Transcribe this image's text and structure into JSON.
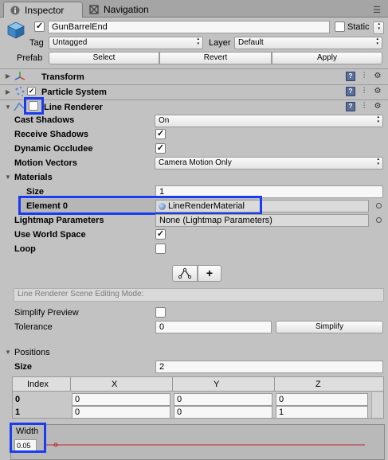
{
  "tabs": [
    {
      "label": "Inspector",
      "icon": "info-icon"
    },
    {
      "label": "Navigation",
      "icon": "navigation-icon"
    }
  ],
  "header": {
    "object_name": "GunBarrelEnd",
    "static_label": "Static",
    "tag_label": "Tag",
    "tag_value": "Untagged",
    "layer_label": "Layer",
    "layer_value": "Default",
    "prefab_label": "Prefab",
    "prefab_buttons": [
      "Select",
      "Revert",
      "Apply"
    ]
  },
  "components": {
    "transform": "Transform",
    "particle_system": "Particle System",
    "line_renderer": "Line Renderer"
  },
  "line_renderer": {
    "cast_shadows_label": "Cast Shadows",
    "cast_shadows_value": "On",
    "receive_shadows_label": "Receive Shadows",
    "dynamic_occludee_label": "Dynamic Occludee",
    "motion_vectors_label": "Motion Vectors",
    "motion_vectors_value": "Camera Motion Only",
    "materials_label": "Materials",
    "size_label": "Size",
    "size_value": "1",
    "element0_label": "Element 0",
    "element0_value": "LineRenderMaterial",
    "lightmap_label": "Lightmap Parameters",
    "lightmap_value": "None (Lightmap Parameters)",
    "world_space_label": "Use World Space",
    "loop_label": "Loop",
    "scene_editing_mode": "Line Renderer Scene Editing Mode:",
    "simplify_preview_label": "Simplify Preview",
    "tolerance_label": "Tolerance",
    "tolerance_value": "0",
    "simplify_button": "Simplify",
    "positions_label": "Positions",
    "positions_size_label": "Size",
    "positions_size_value": "2",
    "table_headers": [
      "Index",
      "X",
      "Y",
      "Z"
    ],
    "rows": [
      [
        "0",
        "0",
        "0",
        "0"
      ],
      [
        "1",
        "0",
        "0",
        "1"
      ]
    ],
    "width_label": "Width",
    "width_value": "0.05"
  },
  "colors": {
    "highlight": "#1a3cf0",
    "curve": "#c0282b"
  }
}
